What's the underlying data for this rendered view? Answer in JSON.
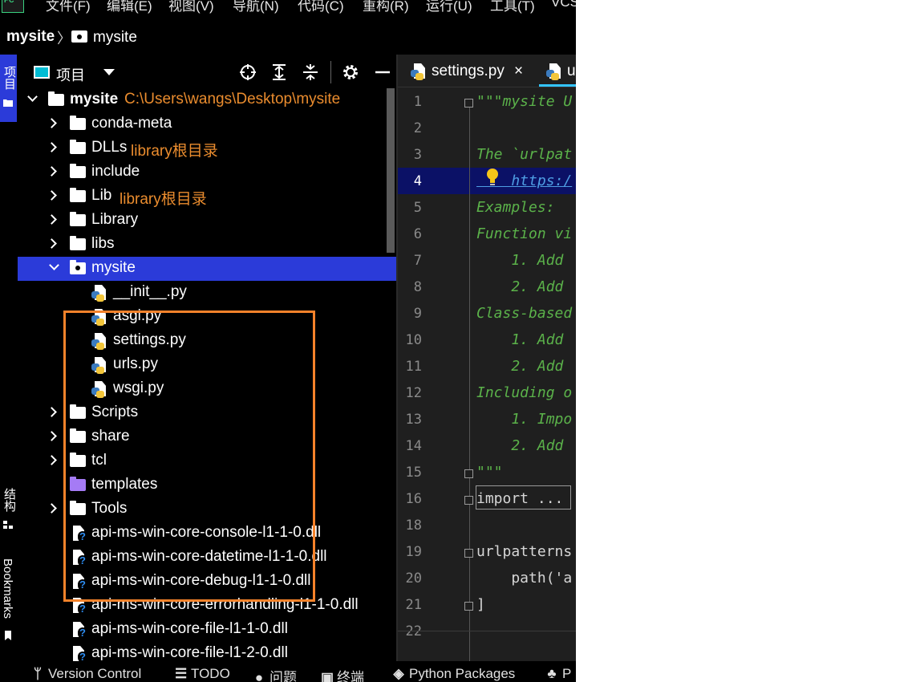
{
  "app": {
    "logo_text": "PC"
  },
  "menu": [
    "文件(F)",
    "编辑(E)",
    "视图(V)",
    "导航(N)",
    "代码(C)",
    "重构(R)",
    "运行(U)",
    "工具(T)",
    "VCS"
  ],
  "breadcrumb": {
    "root": "mysite",
    "separator": "〉",
    "leaf": "mysite"
  },
  "left_strip": {
    "project": "项目",
    "structure": "结构",
    "bookmarks": "Bookmarks"
  },
  "project_panel": {
    "title": "项目",
    "header_icons": [
      "locate-icon",
      "expand-all-icon",
      "collapse-all-icon",
      "gear-icon",
      "minimize-icon"
    ],
    "tree": [
      {
        "label": "mysite",
        "note": "C:\\Users\\wangs\\Desktop\\mysite",
        "icon": "folder",
        "expanded": true,
        "level": 0
      },
      {
        "label": "conda-meta",
        "icon": "folder",
        "level": 1
      },
      {
        "label": "DLLs",
        "note": "library根目录",
        "icon": "folder",
        "level": 1
      },
      {
        "label": "include",
        "icon": "folder",
        "level": 1
      },
      {
        "label": "Lib",
        "note": "library根目录",
        "icon": "folder",
        "level": 1
      },
      {
        "label": "Library",
        "icon": "folder",
        "level": 1
      },
      {
        "label": "libs",
        "icon": "folder",
        "level": 1
      },
      {
        "label": "mysite",
        "icon": "package-folder",
        "expanded": true,
        "selected": true,
        "level": 1
      },
      {
        "label": "__init__.py",
        "icon": "python-file",
        "level": 2
      },
      {
        "label": "asgi.py",
        "icon": "python-file",
        "level": 2
      },
      {
        "label": "settings.py",
        "icon": "python-file",
        "level": 2
      },
      {
        "label": "urls.py",
        "icon": "python-file",
        "level": 2
      },
      {
        "label": "wsgi.py",
        "icon": "python-file",
        "level": 2
      },
      {
        "label": "Scripts",
        "icon": "folder",
        "level": 1
      },
      {
        "label": "share",
        "icon": "folder",
        "level": 1
      },
      {
        "label": "tcl",
        "icon": "folder",
        "level": 1
      },
      {
        "label": "templates",
        "icon": "templates-folder",
        "level": 1
      },
      {
        "label": "Tools",
        "icon": "folder",
        "level": 1
      },
      {
        "label": "api-ms-win-core-console-l1-1-0.dll",
        "icon": "unknown-file",
        "level": 1
      },
      {
        "label": "api-ms-win-core-datetime-l1-1-0.dll",
        "icon": "unknown-file",
        "level": 1
      },
      {
        "label": "api-ms-win-core-debug-l1-1-0.dll",
        "icon": "unknown-file",
        "level": 1
      },
      {
        "label": "api-ms-win-core-errorhandling-l1-1-0.dll",
        "icon": "unknown-file",
        "level": 1
      },
      {
        "label": "api-ms-win-core-file-l1-1-0.dll",
        "icon": "unknown-file",
        "level": 1
      },
      {
        "label": "api-ms-win-core-file-l1-2-0.dll",
        "icon": "unknown-file",
        "level": 1
      }
    ]
  },
  "editor": {
    "tabs": [
      {
        "label": "settings.py",
        "close": "×"
      },
      {
        "label": "u"
      }
    ],
    "current_line": 4,
    "lines": [
      {
        "n": "1",
        "text": "\"\"\"mysite U",
        "style": "doc"
      },
      {
        "n": "2",
        "text": "",
        "style": "doc"
      },
      {
        "n": "3",
        "text": "The `urlpat",
        "style": "doc"
      },
      {
        "n": "4",
        "text": "    https:/",
        "style": "link"
      },
      {
        "n": "5",
        "text": "Examples:",
        "style": "doc"
      },
      {
        "n": "6",
        "text": "Function vi",
        "style": "doc"
      },
      {
        "n": "7",
        "text": "    1. Add",
        "style": "doc"
      },
      {
        "n": "8",
        "text": "    2. Add",
        "style": "doc"
      },
      {
        "n": "9",
        "text": "Class-based",
        "style": "doc"
      },
      {
        "n": "10",
        "text": "    1. Add",
        "style": "doc"
      },
      {
        "n": "11",
        "text": "    2. Add",
        "style": "doc"
      },
      {
        "n": "12",
        "text": "Including o",
        "style": "doc"
      },
      {
        "n": "13",
        "text": "    1. Impo",
        "style": "doc"
      },
      {
        "n": "14",
        "text": "    2. Add",
        "style": "doc"
      },
      {
        "n": "15",
        "text": "\"\"\"",
        "style": "doc"
      },
      {
        "n": "16",
        "text": "import ...",
        "style": "plain"
      },
      {
        "n": "18",
        "text": "",
        "style": "plain"
      },
      {
        "n": "19",
        "text": "urlpatterns",
        "style": "plain"
      },
      {
        "n": "20",
        "text": "    path('a",
        "style": "plain"
      },
      {
        "n": "21",
        "text": "]",
        "style": "plain"
      },
      {
        "n": "22",
        "text": "",
        "style": "plain"
      }
    ]
  },
  "bottom_bar": [
    {
      "label": "Version Control",
      "icon": "branch-icon"
    },
    {
      "label": "TODO",
      "icon": "list-icon"
    },
    {
      "label": "问题",
      "icon": "problems-icon"
    },
    {
      "label": "终端",
      "icon": "terminal-icon"
    },
    {
      "label": "Python Packages",
      "icon": "packages-icon"
    },
    {
      "label": "P",
      "icon": "python-console-icon"
    }
  ],
  "colors": {
    "selection": "#2b3bd9",
    "highlight_box": "#f5822a",
    "note_text": "#ea8c2e",
    "docstring": "#5bb24a",
    "current_line": "#0b1166",
    "tab_underline": "#33c4ff"
  }
}
